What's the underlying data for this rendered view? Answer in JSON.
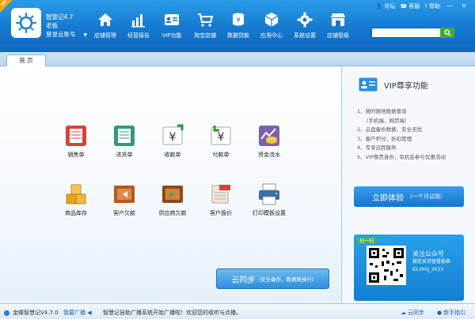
{
  "app": {
    "name": "智慧记4.7",
    "user": "老板",
    "login": "登录云账号",
    "vip_corner": "VIP",
    "version_label": "金蝶智慧记V4.7.0"
  },
  "nav": [
    {
      "label": "店铺管理",
      "icon": "home-icon"
    },
    {
      "label": "经营报告",
      "icon": "bar-chart-icon"
    },
    {
      "label": "VIP功能",
      "icon": "vip-card-icon"
    },
    {
      "label": "淘宝店铺",
      "icon": "cart-icon"
    },
    {
      "label": "数据贷款",
      "icon": "coin-stack-icon"
    },
    {
      "label": "应用中心",
      "icon": "cube-icon"
    },
    {
      "label": "系统设置",
      "icon": "gear-icon"
    },
    {
      "label": "店铺管级",
      "icon": "shop-icon"
    }
  ],
  "top_links": {
    "forum": "论坛",
    "service": "客服",
    "help": "帮助"
  },
  "tabs": {
    "home": "首 页"
  },
  "functions": [
    {
      "label": "销售单",
      "icon": "sales-order-icon",
      "color": "#d9403a"
    },
    {
      "label": "进货单",
      "icon": "purchase-order-icon",
      "color": "#2f9a7a"
    },
    {
      "label": "收款单",
      "icon": "receipt-icon",
      "color": "#3c8f3a"
    },
    {
      "label": "付款单",
      "icon": "payment-icon",
      "color": "#3c8f3a"
    },
    {
      "label": "资金流水",
      "icon": "cash-flow-icon",
      "color": "#7b5fb0"
    },
    {
      "label": "商品库存",
      "icon": "inventory-icon",
      "color": "#e6a21c"
    },
    {
      "label": "客户欠款",
      "icon": "customer-debt-icon",
      "color": "#b35a1e"
    },
    {
      "label": "供应商欠款",
      "icon": "supplier-debt-icon",
      "color": "#2f8a4a"
    },
    {
      "label": "客户报价",
      "icon": "quote-icon",
      "color": "#d9403a"
    },
    {
      "label": "打印模板设置",
      "icon": "printer-icon",
      "color": "#3a6fb0"
    }
  ],
  "sync": {
    "label": "云同步",
    "hint": "(安全备份，数据随身行)"
  },
  "vip": {
    "title": "VIP尊享功能",
    "items": [
      "1、随时随地数据查询",
      "（手机端、网页端）",
      "2、云盘备份数据，安全无忧",
      "3、客户积分，折扣管理",
      "4、专享远程服务",
      "5、VIP尊贵身份，有机会参与优惠活动"
    ],
    "button": "立即体验",
    "button_hint": "（一个月试用）"
  },
  "qr": {
    "ribbon": "扫一扫",
    "title": "关注公众号",
    "line1": "微信支持查看报表",
    "line2": "ID:zhhj_2013"
  },
  "status": {
    "broadcast_link": "我要广播",
    "message": "智慧记自助广播系统开始广播啦！欢迎您的收听与点播。",
    "cloud_sync": "云同步",
    "newbie": "新手指引"
  },
  "colors": {
    "header": "#1579cf",
    "accent": "#2f8fdc",
    "green": "#45a83a"
  }
}
